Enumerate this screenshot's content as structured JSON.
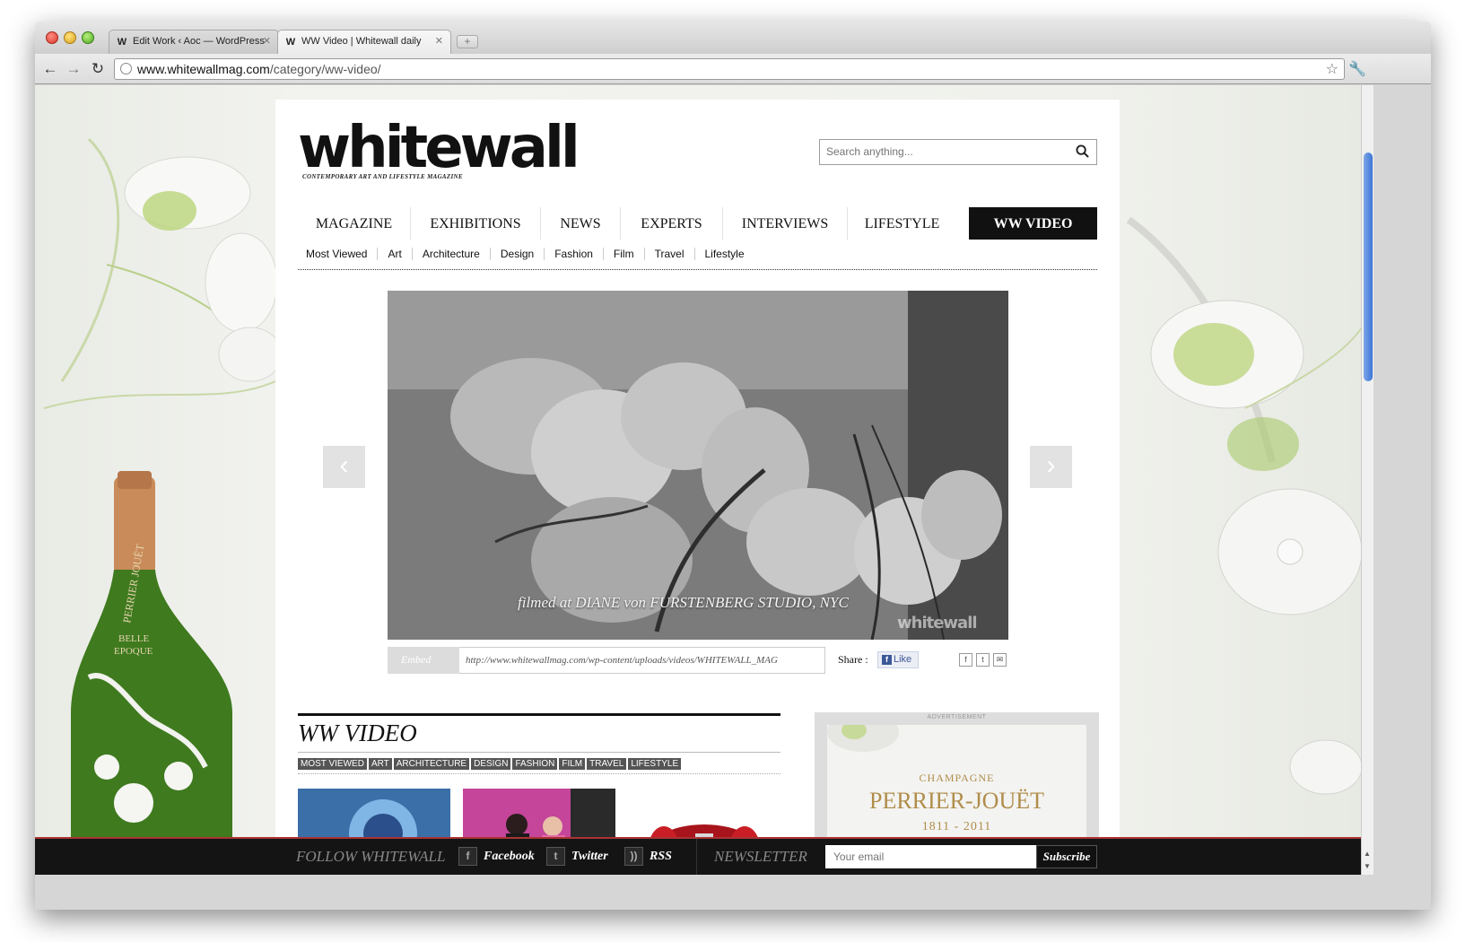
{
  "browser": {
    "tabs": [
      {
        "title": "Edit Work ‹ Aoc — WordPress",
        "favicon": "W"
      },
      {
        "title": "WW Video | Whitewall daily",
        "favicon": "W"
      }
    ],
    "url_host": "www.whitewallmag.com",
    "url_path": "/category/ww-video/"
  },
  "site": {
    "logo": "whitewall",
    "tagline": "CONTEMPORARY ART AND LIFESTYLE MAGAZINE",
    "search_placeholder": "Search anything..."
  },
  "nav": {
    "main": [
      "MAGAZINE",
      "EXHIBITIONS",
      "NEWS",
      "EXPERTS",
      "INTERVIEWS",
      "LIFESTYLE",
      "WW VIDEO"
    ],
    "active": "WW VIDEO",
    "sub": [
      "Most Viewed",
      "Art",
      "Architecture",
      "Design",
      "Fashion",
      "Film",
      "Travel",
      "Lifestyle"
    ]
  },
  "video": {
    "caption": "filmed at DIANE von FURSTENBERG STUDIO, NYC",
    "watermark": "whitewall",
    "embed_label": "Embed",
    "embed_url": "http://www.whitewallmag.com/wp-content/uploads/videos/WHITEWALL_MAG",
    "share_label": "Share :",
    "like_label": "Like"
  },
  "section": {
    "title": "WW VIDEO",
    "tags": [
      "MOST VIEWED",
      "ART",
      "ARCHITECTURE",
      "DESIGN",
      "FASHION",
      "FILM",
      "TRAVEL",
      "LIFESTYLE"
    ]
  },
  "ad": {
    "label": "ADVERTISEMENT",
    "line1": "CHAMPAGNE",
    "brand": "PERRIER-JOUËT",
    "years": "1811 - 2011"
  },
  "footer": {
    "follow": "FOLLOW WHITEWALL",
    "social": [
      "Facebook",
      "Twitter",
      "RSS"
    ],
    "newsletter": "NEWSLETTER",
    "email_placeholder": "Your email",
    "subscribe": "Subscribe"
  },
  "colors": {
    "nav_active_bg": "#111111",
    "footer_bg": "#141414",
    "ad_gold": "#b08d4a"
  }
}
